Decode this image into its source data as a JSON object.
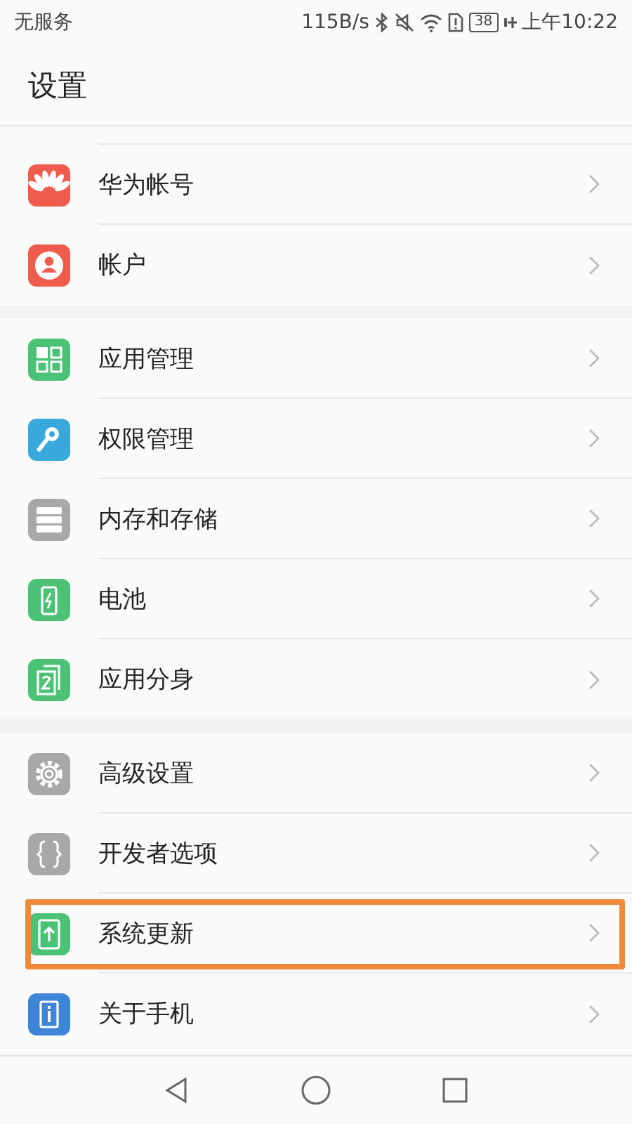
{
  "status_bar": {
    "carrier": "无服务",
    "speed": "115B/s",
    "battery": "38",
    "time": "上午10:22"
  },
  "header": {
    "title": "设置"
  },
  "groups": [
    {
      "items": [
        {
          "label": "华为帐号",
          "kind": "petals",
          "highlighted": false
        },
        {
          "label": "帐户",
          "kind": "person",
          "highlighted": false
        }
      ]
    },
    {
      "items": [
        {
          "label": "应用管理",
          "kind": "grid",
          "highlighted": false
        },
        {
          "label": "权限管理",
          "kind": "key",
          "highlighted": false
        },
        {
          "label": "内存和存储",
          "kind": "storage",
          "highlighted": false
        },
        {
          "label": "电池",
          "kind": "battery",
          "highlighted": false
        },
        {
          "label": "应用分身",
          "kind": "twin",
          "highlighted": false
        }
      ]
    },
    {
      "items": [
        {
          "label": "高级设置",
          "kind": "gear",
          "highlighted": false
        },
        {
          "label": "开发者选项",
          "kind": "braces",
          "highlighted": false
        },
        {
          "label": "系统更新",
          "kind": "update",
          "highlighted": true
        },
        {
          "label": "关于手机",
          "kind": "info",
          "highlighted": false
        }
      ]
    }
  ]
}
